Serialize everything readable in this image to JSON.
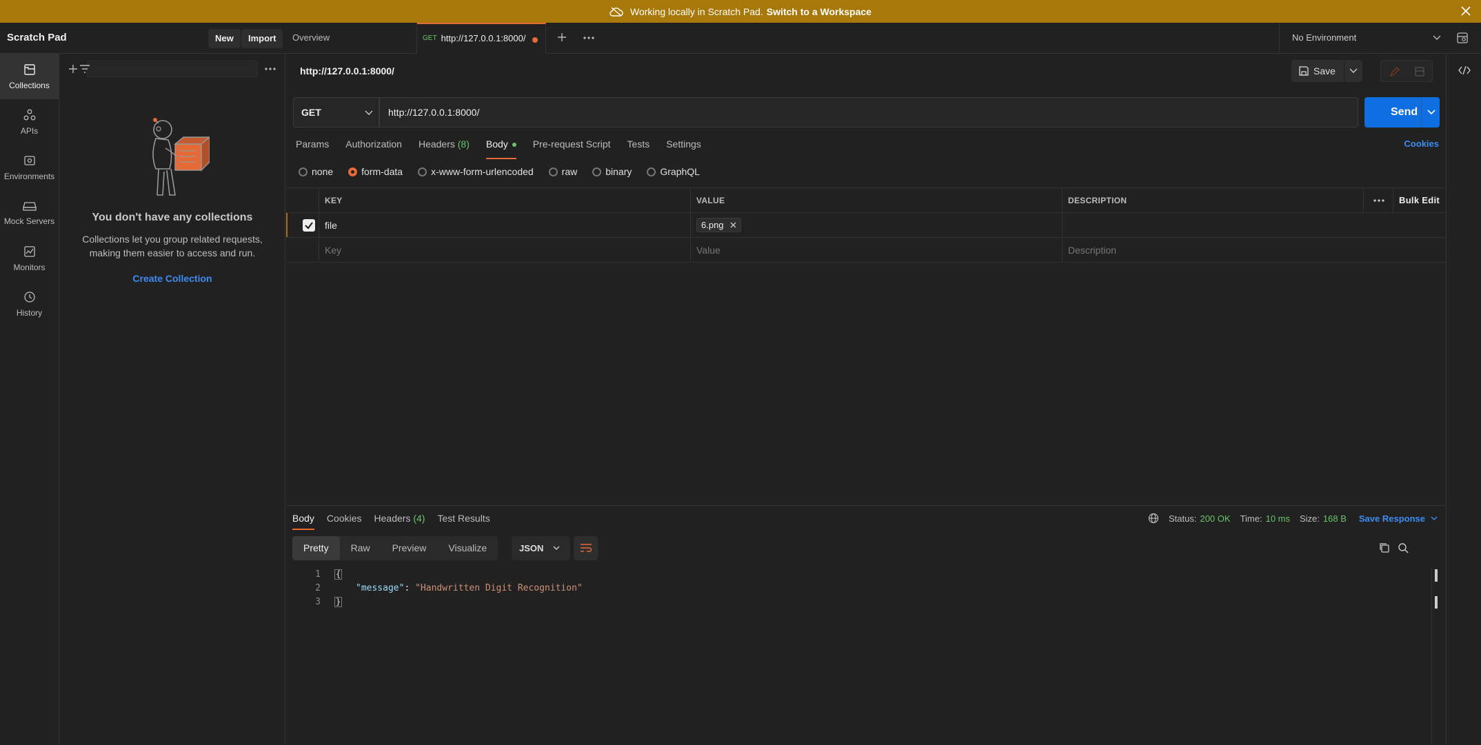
{
  "banner": {
    "text": "Working locally in Scratch Pad.",
    "link": "Switch to a Workspace"
  },
  "header": {
    "workspace": "Scratch Pad",
    "new_label": "New",
    "import_label": "Import",
    "tabs": [
      {
        "label": "Overview"
      },
      {
        "method": "GET",
        "label": "http://127.0.0.1:8000/"
      }
    ],
    "environment": "No Environment"
  },
  "rail": [
    {
      "label": "Collections",
      "icon": "collections-icon"
    },
    {
      "label": "APIs",
      "icon": "apis-icon"
    },
    {
      "label": "Environments",
      "icon": "environments-icon"
    },
    {
      "label": "Mock Servers",
      "icon": "mock-servers-icon"
    },
    {
      "label": "Monitors",
      "icon": "monitors-icon"
    },
    {
      "label": "History",
      "icon": "history-icon"
    }
  ],
  "sidebar": {
    "empty_title": "You don't have any collections",
    "empty_desc_1": "Collections let you group related requests,",
    "empty_desc_2": "making them easier to access and run.",
    "create_label": "Create Collection"
  },
  "request": {
    "title": "http://127.0.0.1:8000/",
    "save_label": "Save",
    "method": "GET",
    "url": "http://127.0.0.1:8000/",
    "send_label": "Send",
    "tabs": [
      {
        "label": "Params"
      },
      {
        "label": "Authorization"
      },
      {
        "label": "Headers",
        "count": "(8)"
      },
      {
        "label": "Body"
      },
      {
        "label": "Pre-request Script"
      },
      {
        "label": "Tests"
      },
      {
        "label": "Settings"
      }
    ],
    "cookies_label": "Cookies",
    "body_types": [
      "none",
      "form-data",
      "x-www-form-urlencoded",
      "raw",
      "binary",
      "GraphQL"
    ],
    "selected_body_type": "form-data",
    "table": {
      "headers": {
        "key": "KEY",
        "value": "VALUE",
        "description": "DESCRIPTION",
        "bulk": "Bulk Edit"
      },
      "rows": [
        {
          "key": "file",
          "value": "6.png",
          "checked": true
        }
      ],
      "placeholders": {
        "key": "Key",
        "value": "Value",
        "description": "Description"
      }
    }
  },
  "response": {
    "tabs": [
      {
        "label": "Body"
      },
      {
        "label": "Cookies"
      },
      {
        "label": "Headers",
        "count": "(4)"
      },
      {
        "label": "Test Results"
      }
    ],
    "status_label": "Status:",
    "status": "200 OK",
    "time_label": "Time:",
    "time": "10 ms",
    "size_label": "Size:",
    "size": "168 B",
    "save_label": "Save Response",
    "view_modes": [
      "Pretty",
      "Raw",
      "Preview",
      "Visualize"
    ],
    "format": "JSON",
    "code": {
      "open": "{",
      "key": "\"message\"",
      "colon": ": ",
      "value": "\"Handwritten Digit Recognition\"",
      "close": "}"
    }
  },
  "colors": {
    "accent": "#e66a36",
    "primary": "#0f6fe0",
    "banner": "#a8790a",
    "success": "#6bc46b"
  }
}
